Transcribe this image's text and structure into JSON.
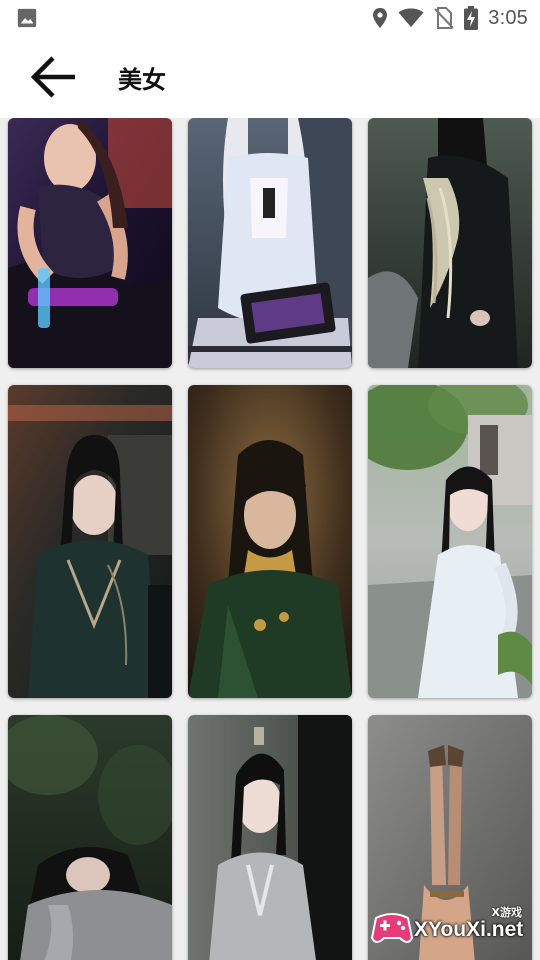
{
  "status_bar": {
    "time": "3:05",
    "icons": [
      "image-icon",
      "location-icon",
      "wifi-icon",
      "no-sim-icon",
      "battery-charging-icon"
    ]
  },
  "app_bar": {
    "back_icon": "arrow-back-icon",
    "title": "美女"
  },
  "gallery": {
    "items": [
      {
        "subject": "tattooed woman on neon motorcycle"
      },
      {
        "subject": "white-haired woman with keyboard"
      },
      {
        "subject": "woman in dark feathered robe"
      },
      {
        "subject": "woman in dark green outfit"
      },
      {
        "subject": "woman in green cloak, warm light"
      },
      {
        "subject": "woman in white hanfu by tree"
      },
      {
        "subject": "woman resting in forest"
      },
      {
        "subject": "woman in grey robe with hairpin"
      },
      {
        "subject": "legs against grey wall"
      }
    ]
  },
  "watermark": {
    "small_text": "X游戏",
    "main_text": "XYouXi.net"
  },
  "colors": {
    "background": "#efefef",
    "bar": "#ffffff",
    "title": "#111111",
    "status_icon": "#555555"
  }
}
